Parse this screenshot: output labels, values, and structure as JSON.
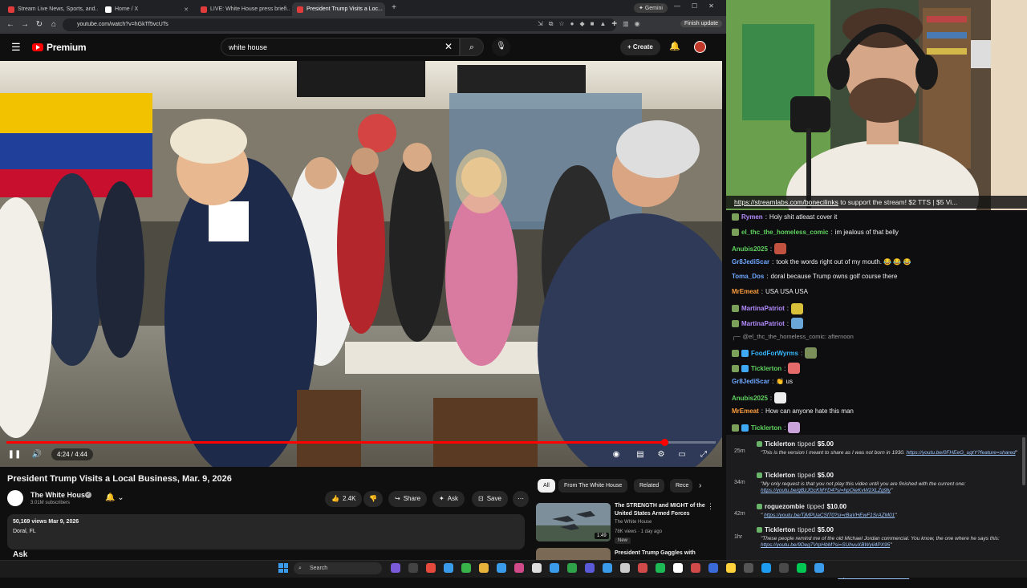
{
  "browser": {
    "tabs": [
      {
        "label": "Stream Live News, Sports, and...",
        "color": "#e23b3b",
        "active": false
      },
      {
        "label": "Home / X",
        "color": "#ffffff",
        "active": false
      },
      {
        "label": "LIVE: White House press briefi...",
        "color": "#e23b3b",
        "active": false
      },
      {
        "label": "President Trump Visits a Loc...",
        "color": "#e23b3b",
        "active": true
      }
    ],
    "gemini_label": "Gemini",
    "url": "youtube.com/watch?v=hGkTf5vcUTs",
    "finish_update": "Finish update"
  },
  "youtube": {
    "logo_text": "Premium",
    "search_value": "white house",
    "create_label": "Create",
    "video": {
      "time": "4:24 / 4:44",
      "progress_fraction": 0.928
    },
    "title": "President Trump Visits a Local Business, Mar. 9, 2026",
    "channel": {
      "name": "The White House",
      "subscribers": "3.01M subscribers"
    },
    "actions": {
      "likes": "2.4K",
      "share": "Share",
      "ask": "Ask",
      "save": "Save"
    },
    "description": {
      "stats": "50,169 views  Mar 9, 2026",
      "location": "Doral, FL"
    },
    "ask_heading": "Ask",
    "chips": [
      "All",
      "From The White House",
      "Related",
      "Rece"
    ],
    "recommended": [
      {
        "title": "The STRENGTH and MIGHT of the United States Armed Forces",
        "channel": "The White House",
        "meta": "78K views · 1 day ago",
        "badge": "New",
        "duration": "1:49"
      },
      {
        "title": "President Trump Gaggles with"
      }
    ]
  },
  "taskbar": {
    "search_label": "Search"
  },
  "stream": {
    "banner_link": "https://streamlabs.com/bonecilinks",
    "banner_text": " to support the stream! $2 TTS | $5 Vi..."
  },
  "chat": [
    {
      "user": "Rymen",
      "color": "#b48cff",
      "text": "Holy shit atleast cover it",
      "badge": "#7aa05a"
    },
    {
      "user": "el_thc_the_homeless_comic",
      "color": "#5fd35f",
      "text": "im jealous of that belly",
      "badge": "#7aa05a"
    },
    {
      "user": "Anubis2025",
      "color": "#5fd35f",
      "text": "",
      "emote": "#c0523f"
    },
    {
      "user": "Gr8JediScar",
      "color": "#6fa8ff",
      "text": "took the words right out of my mouth. 😂 😂 😂"
    },
    {
      "user": "Toma_Dos",
      "color": "#6fa8ff",
      "text": "doral because Trump owns golf course there"
    },
    {
      "user": "MrEmeat",
      "color": "#ff9e3d",
      "text": "USA USA USA"
    },
    {
      "user": "MartinaPatriot",
      "color": "#b48cff",
      "text": "",
      "emote": "#d8c03a",
      "badge": "#7aa05a"
    },
    {
      "user": "MartinaPatriot",
      "color": "#b48cff",
      "text": "",
      "emote": "#6aa7d8",
      "badge": "#7aa05a"
    },
    {
      "reply": "@el_thc_the_homeless_comic: afternoon"
    },
    {
      "user": "FoodForWyrms",
      "color": "#37b8ff",
      "text": "",
      "emote": "#7a8f5a",
      "badge": "#7aa05a",
      "badge2": "#3fa9f5"
    },
    {
      "user": "Ticklerton",
      "color": "#5fd35f",
      "text": "",
      "emote": "#e56b6b",
      "badge": "#7aa05a",
      "badge2": "#3fa9f5"
    },
    {
      "user": "Gr8JediScar",
      "color": "#6fa8ff",
      "text": "👏 us"
    },
    {
      "user": "Anubis2025",
      "color": "#5fd35f",
      "text": "",
      "emote": "#eeeeee"
    },
    {
      "user": "MrEmeat",
      "color": "#ff9e3d",
      "text": "How can anyone hate this man"
    },
    {
      "user": "Ticklerton",
      "color": "#5fd35f",
      "text": "",
      "emote": "#c9a3d9",
      "badge": "#7aa05a",
      "badge2": "#3fa9f5"
    }
  ],
  "tips": [
    {
      "time": "25m",
      "user": "Ticklerton",
      "action": "tipped",
      "amount": "$5.00",
      "message": "\"This is the version I meant to share as I was not born in 1930.",
      "link": "https://youtu.be/0FHEeG_ugtY?feature=shared",
      "end": "\""
    },
    {
      "time": "34m",
      "user": "Ticklerton",
      "action": "tipped",
      "amount": "$5.00",
      "message": "\"My only request is that you not play this video until you are finished with the current one:",
      "link": "https://youtu.be/gBzJGcKMYD4?si=hpOieKvW2XLZg9ly",
      "end": "\""
    },
    {
      "time": "42m",
      "user": "roguezombie",
      "action": "tipped",
      "amount": "$10.00",
      "message": "\"",
      "link": "https://youtu.be/TjMPUaCSf70?si=rBaVHEwF1SrAZM01",
      "end": "\""
    },
    {
      "time": "1hr",
      "user": "Ticklerton",
      "action": "tipped",
      "amount": "$5.00",
      "message": "\"These people remind me of the old Michael Jordan commercial. You know, the one where he says this:",
      "link": "https://youtu.be/9Deg7VrpHbM?si=SUhvuXBWyli4PX95",
      "end": "\""
    },
    {
      "time": "2hr",
      "user": "Ticklerton",
      "action": "tipped",
      "amount": "$5.00",
      "message": "\"Have an iPhone? Uh! Ohhhhhh!",
      "link": "https://vt.tiktok.com/ZSurStWx/",
      "end": "\""
    }
  ],
  "colors": {
    "yt_red": "#ff0000",
    "bg": "#0f0f0f",
    "chat_bg": "#0e0e10",
    "tips_bg": "#1c1c1f"
  }
}
